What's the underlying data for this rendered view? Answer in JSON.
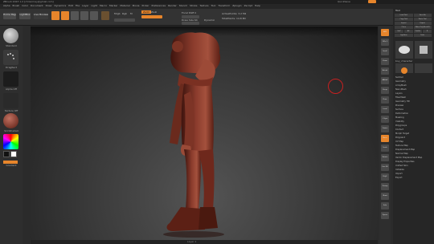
{
  "window": {
    "title": "ZBrush 2023 1.2 [chrisorney@gmail.com]",
    "right_info": "QuickSave",
    "accent": "#e7852b"
  },
  "menu": [
    "Alpha",
    "Brush",
    "Color",
    "Document",
    "Draw",
    "Dynamics",
    "Edit",
    "File",
    "Layer",
    "Light",
    "Macro",
    "Marker",
    "Material",
    "Movie",
    "Picker",
    "Preferences",
    "Render",
    "Stencil",
    "Stroke",
    "Texture",
    "Tool",
    "Transform",
    "Zplugin",
    "Zscript",
    "Help"
  ],
  "toolbar": {
    "home_page": "Home Page",
    "lightbox": "LightBox",
    "live_boolean": "Live Boolean",
    "mrgb": "Mrgb",
    "rgb": "Rgb",
    "m": "M",
    "zadd": "Zadd",
    "zsub": "Zsub",
    "focal_shift_label": "Focal Shift 0",
    "draw_size_label": "Draw Size 64",
    "dynamic": "Dynamic",
    "active_points": "ActivePoints: 3.2 Mil",
    "total_points": "TotalPoints: 14.8 Mil"
  },
  "left_shelf": {
    "brush_label": "Standard",
    "stroke_label": "DragRect",
    "alpha_label": "Alpha Off",
    "texture_label": "Texture Off",
    "material_label": "SkinShade4",
    "gradient_label": "Gradient"
  },
  "viewport": {
    "scrub_label": "Layer 1"
  },
  "right_shelf": {
    "buttons": [
      "BPR",
      "SPix 3",
      "Scroll",
      "Zoom",
      "Actual",
      "AAHalf",
      "Persp",
      "Floor",
      "Local",
      "L.Sym",
      "Frame",
      "Move",
      "Scale",
      "Rotate",
      "Line Fill",
      "PolyF",
      "Transp",
      "Ghost",
      "Solo",
      "Xpose"
    ]
  },
  "tray": {
    "header": "Tool",
    "rows": [
      [
        "Load Tool",
        "Save As"
      ],
      [
        "Copy Tool",
        "Paste Tool"
      ],
      [
        "Import",
        "Export"
      ],
      [
        "Clone",
        "Make PolyMesh3D"
      ],
      [
        "GoZ",
        "All",
        "Visible",
        "R"
      ],
      [
        "Lightbox",
        "Tools"
      ]
    ],
    "current_tool_label": "boy_character",
    "tool_thumbs": [
      "boy_character",
      "PolyMesh3D",
      "SimpleBrush"
    ],
    "subpalettes": [
      "Subtool",
      "Geometry",
      "ArrayMesh",
      "NanoMesh",
      "Layers",
      "FiberMesh",
      "Geometry HD",
      "Preview",
      "Surface",
      "Deformation",
      "Masking",
      "Visibility",
      "Polygroups",
      "Contact",
      "Morph Target",
      "Polypaint",
      "UV Map",
      "Texture Map",
      "Displacement Map",
      "Normal Map",
      "Vector Displacement Map",
      "Display Properties",
      "Unified Skin",
      "Initialize",
      "Import",
      "Export"
    ]
  }
}
